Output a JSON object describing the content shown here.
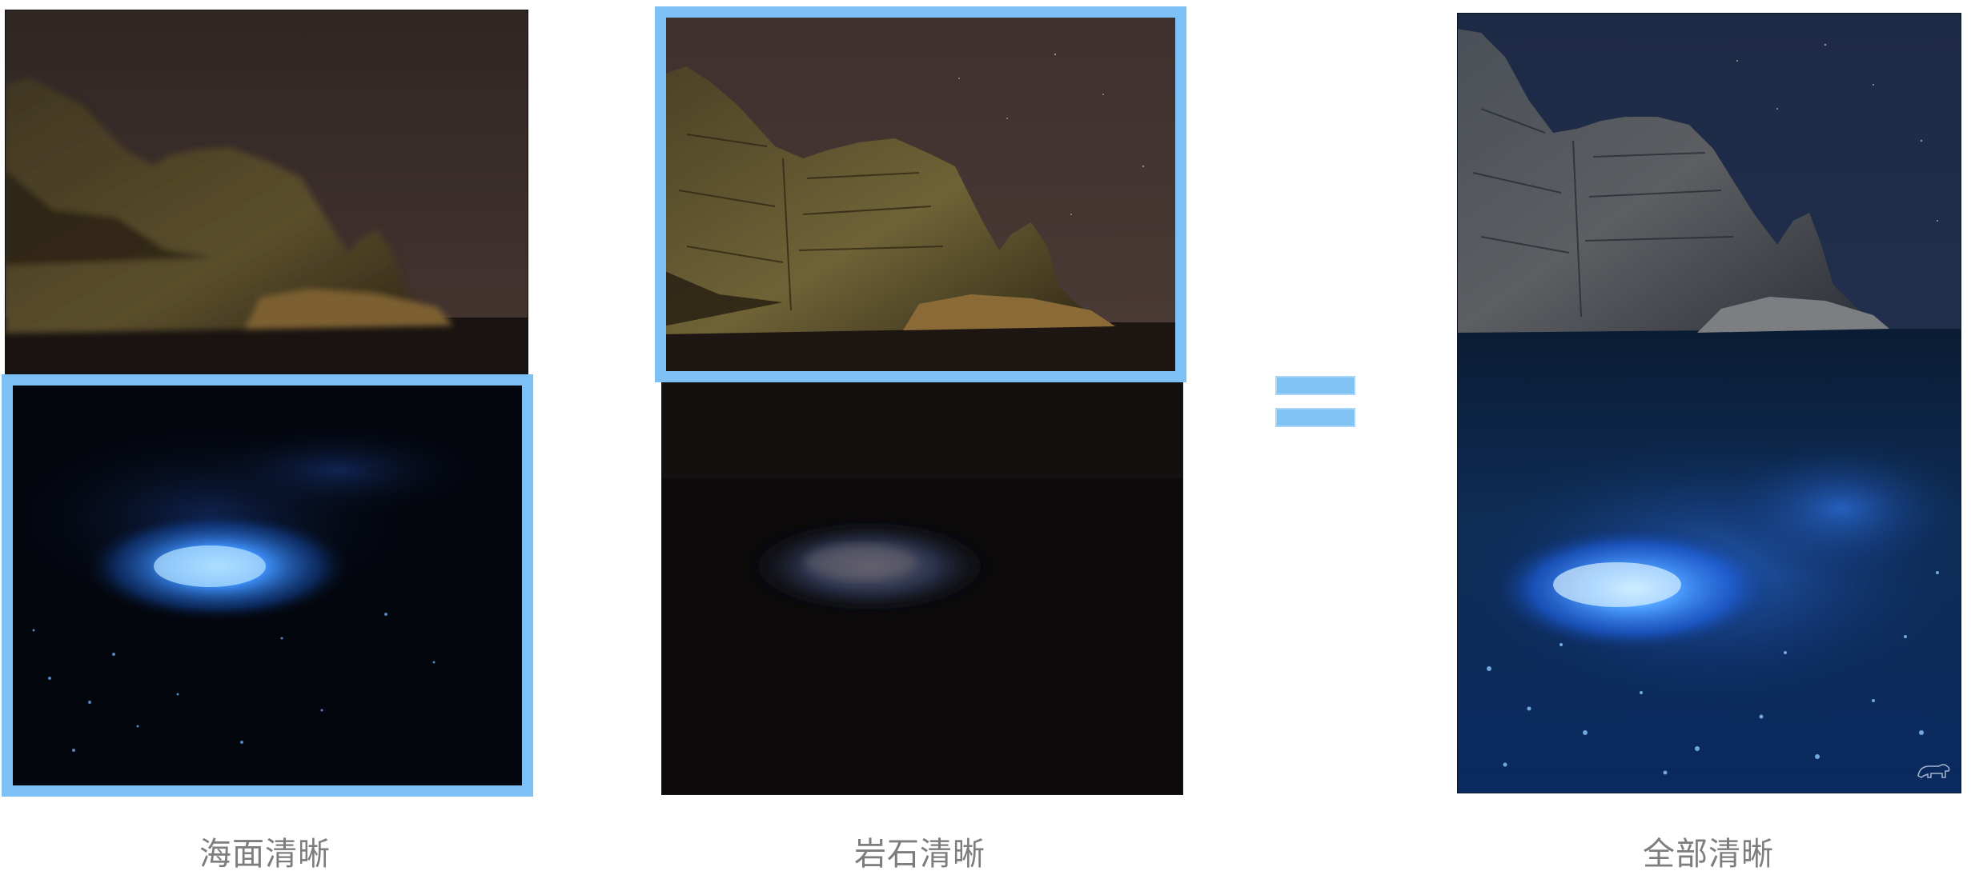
{
  "comparison": {
    "panels": [
      {
        "top_scene": "rock-cliff-night",
        "bottom_scene": "bioluminescent-sea",
        "highlighted": "bottom"
      },
      {
        "top_scene": "rock-cliff-night",
        "bottom_scene": "dark-sea",
        "highlighted": "top"
      },
      {
        "scene": "merged-full-clarity"
      }
    ],
    "captions": {
      "sea_clear": "海面清晰",
      "rock_clear": "岩石清晰",
      "all_clear": "全部清晰"
    },
    "operator": "equals",
    "colors": {
      "highlight": "#7cc0f5",
      "glow": "#3a8cff",
      "caption": "#7d7d7d"
    }
  }
}
